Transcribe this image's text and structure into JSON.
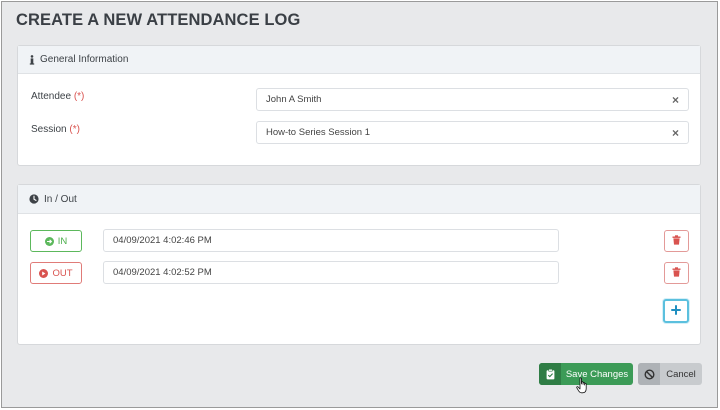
{
  "page": {
    "title": "CREATE A NEW ATTENDANCE LOG"
  },
  "general": {
    "header": "General Information",
    "attendee_label": "Attendee",
    "session_label": "Session",
    "required_marker": "(*)",
    "attendee_value": "John A Smith",
    "session_value": "How-to Series Session 1",
    "clear_glyph": "×"
  },
  "inout": {
    "header": "In / Out",
    "rows": [
      {
        "type_label": "IN",
        "time": "04/09/2021 4:02:46 PM"
      },
      {
        "type_label": "OUT",
        "time": "04/09/2021 4:02:52 PM"
      }
    ],
    "add_glyph": "+"
  },
  "actions": {
    "save_label": "Save Changes",
    "cancel_label": "Cancel"
  },
  "colors": {
    "accent_green": "#3c9b57",
    "in_green": "#5cb85c",
    "out_red": "#d9534f",
    "add_blue": "#5bc0de"
  },
  "icons": {
    "general_header": "info-icon",
    "inout_header": "clock-icon",
    "in_button": "arrow-right-circle-icon",
    "out_button": "arrow-right-circle-icon",
    "delete": "trash-icon",
    "add": "plus-icon",
    "save": "clipboard-check-icon",
    "cancel": "ban-icon"
  }
}
